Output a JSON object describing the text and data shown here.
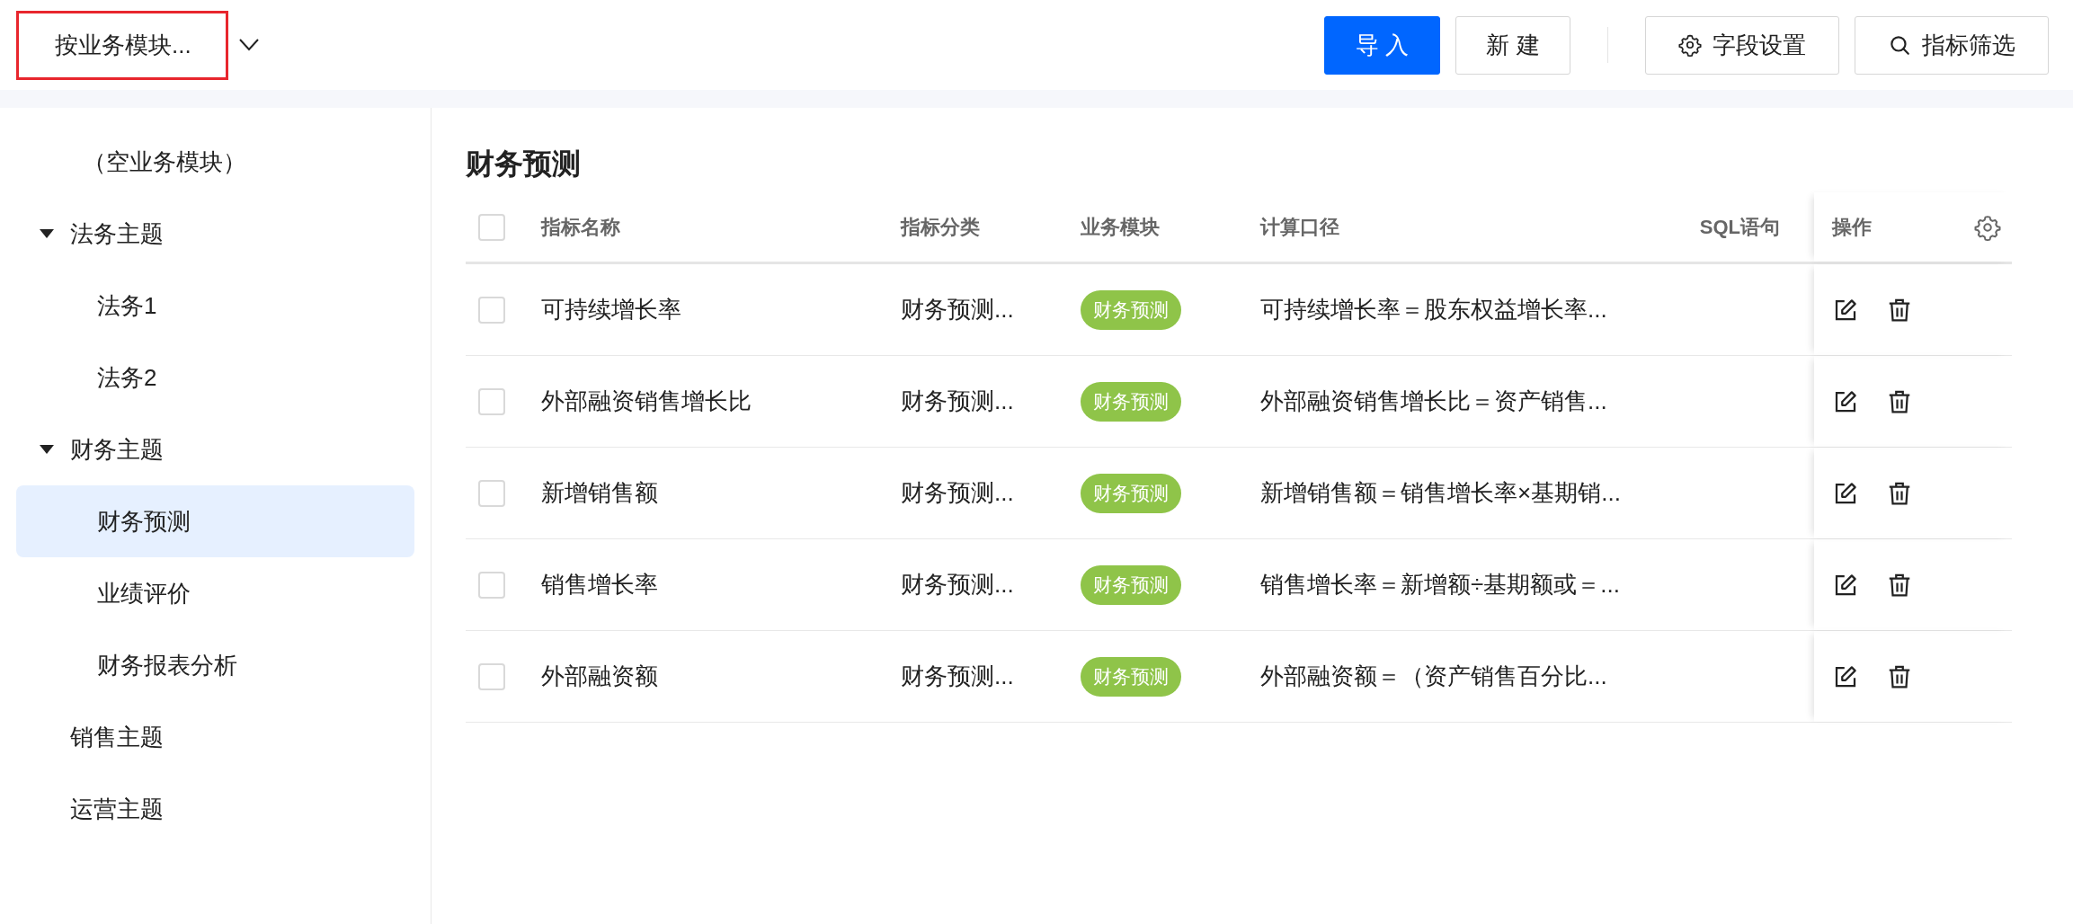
{
  "toolbar": {
    "group_select": {
      "value": "按业务模块..."
    },
    "buttons": [
      {
        "label": "导 入",
        "kind": "primary"
      },
      {
        "label": "新 建",
        "kind": "plain"
      },
      {
        "label": "字段设置",
        "kind": "settings"
      },
      {
        "label": "指标筛选",
        "kind": "filter"
      }
    ]
  },
  "sidebar": {
    "items": [
      {
        "label": "（空业务模块）",
        "selected": false
      },
      {
        "label": "法务主题",
        "selected": false,
        "expanded": true,
        "children": [
          {
            "label": "法务1",
            "selected": false
          },
          {
            "label": "法务2",
            "selected": false
          }
        ]
      },
      {
        "label": "财务主题",
        "selected": false,
        "expanded": true,
        "children": [
          {
            "label": "财务预测",
            "selected": true
          },
          {
            "label": "业绩评价",
            "selected": false
          },
          {
            "label": "财务报表分析",
            "selected": false
          }
        ]
      },
      {
        "label": "销售主题",
        "selected": false
      },
      {
        "label": "运营主题",
        "selected": false
      }
    ]
  },
  "main": {
    "title": "财务预测",
    "table": {
      "all_checked": false,
      "columns": [
        "指标名称",
        "指标分类",
        "业务模块",
        "计算口径",
        "SQL语句",
        "操作"
      ],
      "rows": [
        {
          "checked": false,
          "name": "可持续增长率",
          "category": "财务预测...",
          "module": "财务预测",
          "formula": "可持续增长率＝股东权益增长率..."
        },
        {
          "checked": false,
          "name": "外部融资销售增长比",
          "category": "财务预测...",
          "module": "财务预测",
          "formula": "外部融资销售增长比＝资产销售..."
        },
        {
          "checked": false,
          "name": "新增销售额",
          "category": "财务预测...",
          "module": "财务预测",
          "formula": "新增销售额＝销售增长率×基期销..."
        },
        {
          "checked": false,
          "name": "销售增长率",
          "category": "财务预测...",
          "module": "财务预测",
          "formula": "销售增长率＝新增额÷基期额或＝..."
        },
        {
          "checked": false,
          "name": "外部融资额",
          "category": "财务预测...",
          "module": "财务预测",
          "formula": "外部融资额＝（资产销售百分比..."
        }
      ]
    }
  }
}
